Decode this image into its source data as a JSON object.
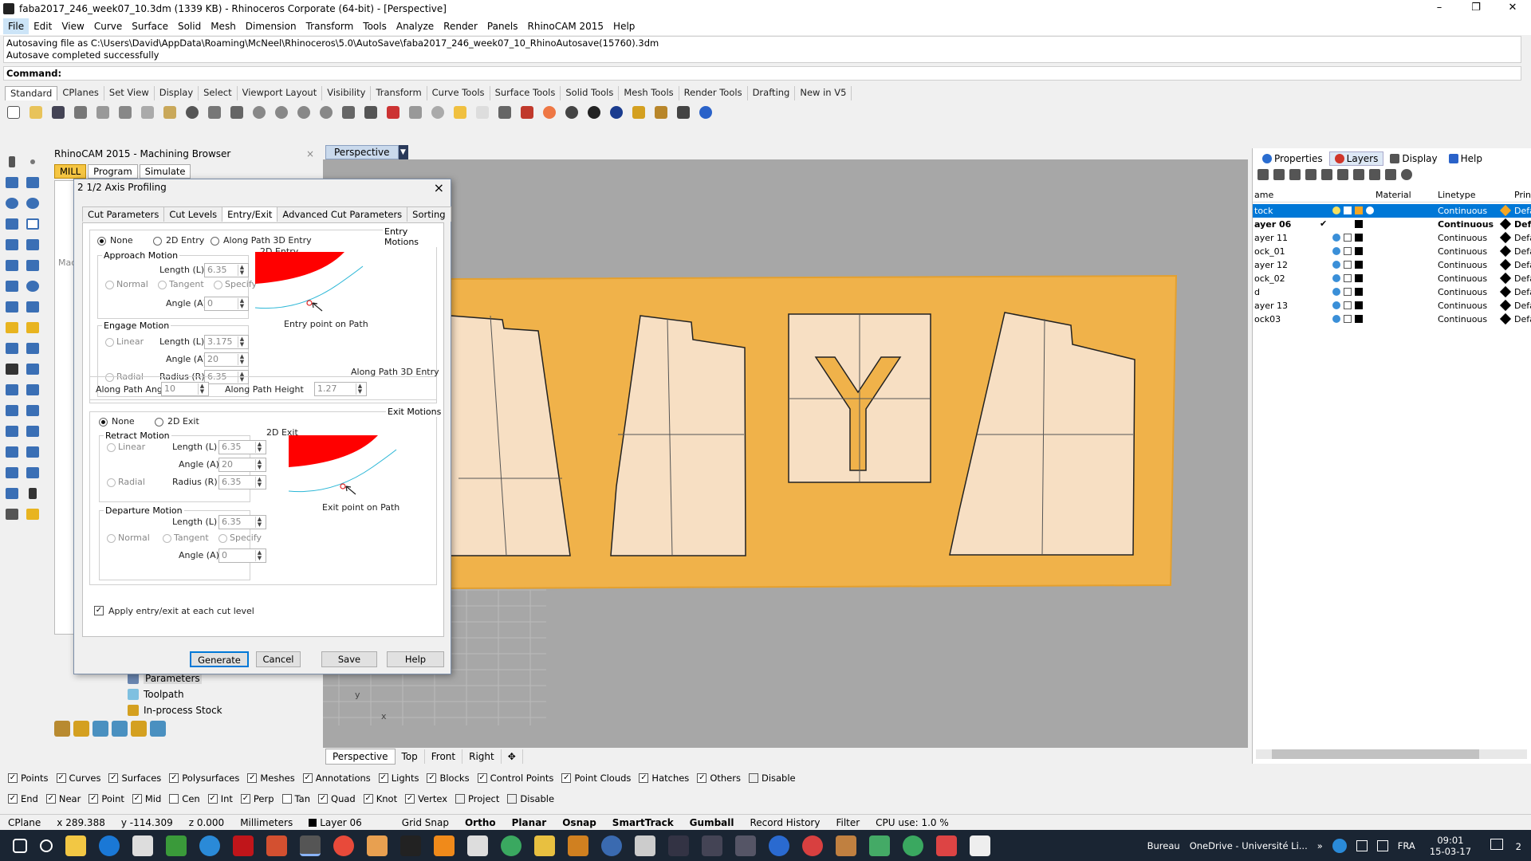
{
  "window": {
    "title": "faba2017_246_week07_10.3dm (1339 KB) - Rhinoceros Corporate (64-bit) - [Perspective]",
    "min": "–",
    "max": "❐",
    "close": "✕"
  },
  "menu": [
    "File",
    "Edit",
    "View",
    "Curve",
    "Surface",
    "Solid",
    "Mesh",
    "Dimension",
    "Transform",
    "Tools",
    "Analyze",
    "Render",
    "Panels",
    "RhinoCAM 2015",
    "Help"
  ],
  "command": {
    "history": [
      "Autosaving file as C:\\Users\\David\\AppData\\Roaming\\McNeel\\Rhinoceros\\5.0\\AutoSave\\faba2017_246_week07_10_RhinoAutosave(15760).3dm",
      "Autosave completed successfully"
    ],
    "prompt": "Command:"
  },
  "toolbar_tabs": [
    "Standard",
    "CPlanes",
    "Set View",
    "Display",
    "Select",
    "Viewport Layout",
    "Visibility",
    "Transform",
    "Curve Tools",
    "Surface Tools",
    "Solid Tools",
    "Mesh Tools",
    "Render Tools",
    "Drafting",
    "New in V5"
  ],
  "rhinocam": {
    "header": "RhinoCAM 2015 - Machining Browser",
    "tabs": [
      "MILL",
      "Program",
      "Simulate"
    ],
    "side_label": "Mac",
    "tree": [
      "Parameters",
      "Toolpath",
      "In-process Stock"
    ]
  },
  "dialog": {
    "title": "2 1/2 Axis Profiling",
    "tabs": [
      "Cut Parameters",
      "Cut Levels",
      "Entry/Exit",
      "Advanced Cut Parameters",
      "Sorting"
    ],
    "entry_motions": "Entry Motions",
    "entry_opts": [
      "None",
      "2D Entry",
      "Along Path 3D Entry"
    ],
    "entry_2d": "2D Entry",
    "approach": {
      "title": "Approach Motion",
      "length_label": "Length (L)",
      "length": "6.35",
      "opts": [
        "Normal",
        "Tangent",
        "Specify"
      ],
      "angle_label": "Angle (A)",
      "angle": "0"
    },
    "engage": {
      "title": "Engage Motion",
      "linear": "Linear",
      "length_label": "Length (L)",
      "length": "3.175",
      "angle_label": "Angle (A)",
      "angle": "20",
      "radial": "Radial",
      "radius_label": "Radius (R)",
      "radius": "6.35"
    },
    "entry_caption": "Entry point on Path",
    "along_path": {
      "title": "Along Path 3D Entry",
      "angle_label": "Along Path Angle",
      "angle": "10",
      "height_label": "Along Path Height",
      "height": "1.27"
    },
    "exit_motions": "Exit Motions",
    "exit_opts": [
      "None",
      "2D Exit"
    ],
    "exit_2d": "2D Exit",
    "retract": {
      "title": "Retract Motion",
      "linear": "Linear",
      "length_label": "Length (L)",
      "length": "6.35",
      "angle_label": "Angle (A)",
      "angle": "20",
      "radial": "Radial",
      "radius_label": "Radius (R)",
      "radius": "6.35"
    },
    "departure": {
      "title": "Departure Motion",
      "length_label": "Length (L)",
      "length": "6.35",
      "opts": [
        "Normal",
        "Tangent",
        "Specify"
      ],
      "angle_label": "Angle (A)",
      "angle": "0"
    },
    "exit_caption": "Exit point on Path",
    "apply": "Apply entry/exit at each cut level",
    "buttons": [
      "Generate",
      "Cancel",
      "Save",
      "Help"
    ]
  },
  "viewport": {
    "name": "Perspective",
    "tabs": [
      "Perspective",
      "Top",
      "Front",
      "Right"
    ],
    "add": "✥",
    "axis_y": "y",
    "axis_x": "x"
  },
  "panel": {
    "tabs": [
      "Properties",
      "Layers",
      "Display",
      "Help"
    ],
    "cols": [
      "ame",
      "Material",
      "Linetype",
      "Prin"
    ],
    "layers": [
      {
        "name": "tock",
        "linetype": "Continuous",
        "print": "Defa",
        "color": "#f5a623"
      },
      {
        "name": "ayer 06",
        "linetype": "Continuous",
        "print": "Def",
        "color": "#000000"
      },
      {
        "name": "ayer 11",
        "linetype": "Continuous",
        "print": "Defa",
        "color": "#000000"
      },
      {
        "name": "ock_01",
        "linetype": "Continuous",
        "print": "Defa",
        "color": "#000000"
      },
      {
        "name": "ayer 12",
        "linetype": "Continuous",
        "print": "Defa",
        "color": "#000000"
      },
      {
        "name": "ock_02",
        "linetype": "Continuous",
        "print": "Defa",
        "color": "#000000"
      },
      {
        "name": "d",
        "linetype": "Continuous",
        "print": "Defa",
        "color": "#000000"
      },
      {
        "name": "ayer 13",
        "linetype": "Continuous",
        "print": "Defa",
        "color": "#000000"
      },
      {
        "name": "ock03",
        "linetype": "Continuous",
        "print": "Defa",
        "color": "#000000"
      }
    ],
    "current_mark": "✔"
  },
  "filters1": [
    "Points",
    "Curves",
    "Surfaces",
    "Polysurfaces",
    "Meshes",
    "Annotations",
    "Lights",
    "Blocks",
    "Control Points",
    "Point Clouds",
    "Hatches",
    "Others",
    "Disable"
  ],
  "filters2": [
    [
      "End",
      true
    ],
    [
      "Near",
      true
    ],
    [
      "Point",
      true
    ],
    [
      "Mid",
      true
    ],
    [
      "Cen",
      false
    ],
    [
      "Int",
      true
    ],
    [
      "Perp",
      true
    ],
    [
      "Tan",
      false
    ],
    [
      "Quad",
      true
    ],
    [
      "Knot",
      true
    ],
    [
      "Vertex",
      true
    ],
    [
      "Project",
      false
    ],
    [
      "Disable",
      false
    ]
  ],
  "status": {
    "cplane": "CPlane",
    "x": "x 289.388",
    "y": "y -114.309",
    "z": "z 0.000",
    "units": "Millimeters",
    "layer": "Layer 06",
    "grid": "Grid Snap",
    "ortho": "Ortho",
    "planar": "Planar",
    "osnap": "Osnap",
    "smarttrack": "SmartTrack",
    "gumball": "Gumball",
    "record": "Record History",
    "filter": "Filter",
    "cpu": "CPU use: 1.0 %"
  },
  "taskbar": {
    "bureau": "Bureau",
    "onedrive": "OneDrive - Université Li...",
    "lang": "FRA",
    "time": "09:01",
    "date": "15-03-17",
    "notif": "2",
    "chev": "»"
  }
}
